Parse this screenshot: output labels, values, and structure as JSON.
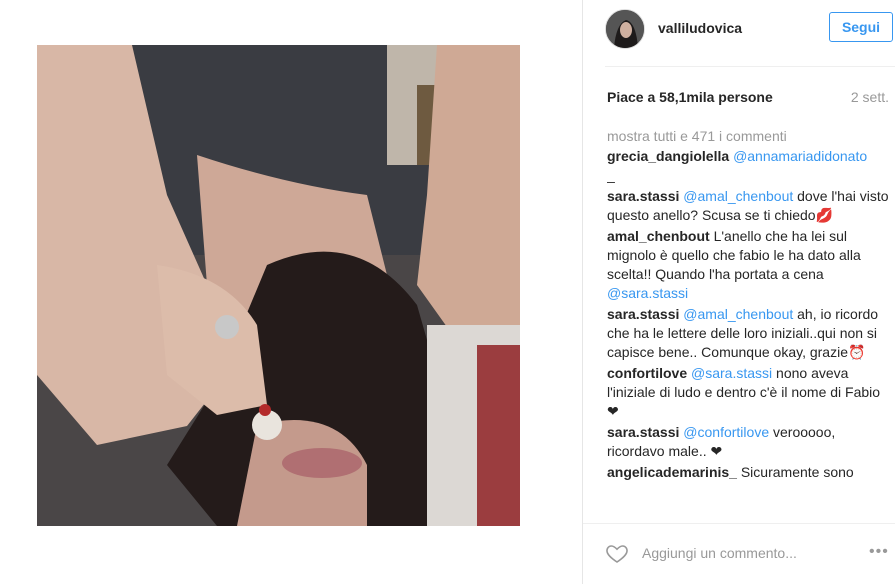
{
  "post": {
    "username": "valliludovica",
    "follow_label": "Segui",
    "likes_text": "Piace a 58,1mila persone",
    "time_ago": "2 sett.",
    "view_all_comments": "mostra tutti e 471 i commenti",
    "comments": [
      {
        "user": "grecia_dangiolella",
        "mention": "@annamariadidonato",
        "text": " _"
      },
      {
        "user": "sara.stassi",
        "mention": "@amal_chenbout",
        "text": " dove l'hai visto questo anello? Scusa se ti chiedo💋"
      },
      {
        "user": "amal_chenbout",
        "mention": "",
        "text": "L'anello che ha lei sul mignolo è quello che fabio le ha dato alla scelta!! Quando l'ha portata a cena ",
        "mention2": "@sara.stassi"
      },
      {
        "user": "sara.stassi",
        "mention": "@amal_chenbout",
        "text": " ah, io ricordo che ha le lettere delle loro iniziali..qui non si capisce bene.. Comunque okay, grazie⏰"
      },
      {
        "user": "confortilove",
        "mention": "@sara.stassi",
        "text": " nono aveva l'iniziale di ludo e dentro c'è il nome di Fabio ❤"
      },
      {
        "user": "sara.stassi",
        "mention": "@confortilove",
        "text": " verooooo, ricordavo male.. ❤"
      },
      {
        "user": "angelicademarinis_",
        "mention": "",
        "text": "Sicuramente sono"
      }
    ],
    "add_comment_placeholder": "Aggiungi un commento...",
    "more_label": "•••"
  },
  "colors": {
    "accent": "#3897f0",
    "muted": "#999999",
    "text": "#262626"
  }
}
